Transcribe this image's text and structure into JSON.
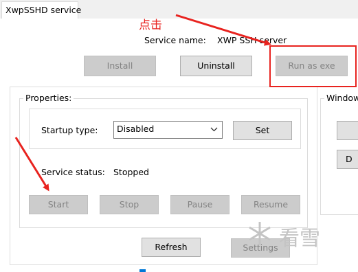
{
  "tab": {
    "label": "XwpSSHD service"
  },
  "service": {
    "name_label": "Service name:",
    "name_value": "XWP SSH server"
  },
  "top_buttons": {
    "install": "Install",
    "uninstall": "Uninstall",
    "run_as_exe": "Run as exe"
  },
  "properties": {
    "title": "Properties:",
    "startup_label": "Startup type:",
    "startup_value": "Disabled",
    "set_label": "Set",
    "status_label": "Service status:",
    "status_value": "Stopped",
    "buttons": {
      "start": "Start",
      "stop": "Stop",
      "pause": "Pause",
      "resume": "Resume"
    }
  },
  "windows_group": {
    "title": "Window",
    "button_2_label": "D"
  },
  "bottom_buttons": {
    "refresh": "Refresh",
    "settings": "Settings"
  },
  "annotation": {
    "text": "点击",
    "color": "#e8231f"
  },
  "watermark": {
    "text": "看雪"
  }
}
